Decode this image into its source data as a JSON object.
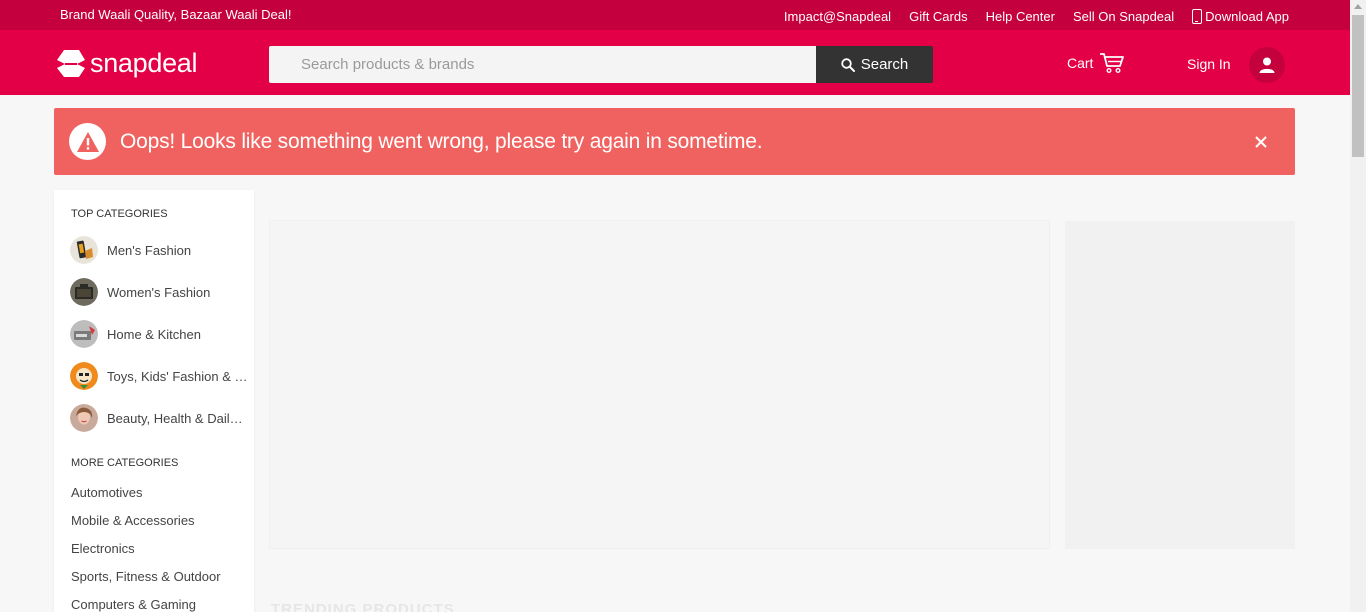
{
  "top_strip": {
    "tagline": "Brand Waali Quality, Bazaar Waali Deal!",
    "links": [
      "Impact@Snapdeal",
      "Gift Cards",
      "Help Center",
      "Sell On Snapdeal"
    ],
    "download_app": "Download App"
  },
  "header": {
    "logo_text": "snapdeal",
    "search_placeholder": "Search products & brands",
    "search_button": "Search",
    "cart_label": "Cart",
    "signin_label": "Sign In"
  },
  "error_banner": {
    "message": "Oops! Looks like something went wrong, please try again in sometime."
  },
  "sidebar": {
    "top_title": "TOP CATEGORIES",
    "top_categories": [
      {
        "label": "Men's Fashion",
        "icon": "mens-fashion-thumb"
      },
      {
        "label": "Women's Fashion",
        "icon": "womens-fashion-thumb"
      },
      {
        "label": "Home & Kitchen",
        "icon": "home-kitchen-thumb"
      },
      {
        "label": "Toys, Kids' Fashion & more",
        "icon": "toys-thumb"
      },
      {
        "label": "Beauty, Health & Daily Needs",
        "icon": "beauty-thumb"
      }
    ],
    "more_title": "MORE CATEGORIES",
    "more_categories": [
      "Automotives",
      "Mobile & Accessories",
      "Electronics",
      "Sports, Fitness & Outdoor",
      "Computers & Gaming"
    ]
  },
  "main": {
    "trending_title": "TRENDING PRODUCTS"
  },
  "colors": {
    "brand": "#e40046",
    "strip": "#c5003e",
    "error": "#f0625f",
    "search_button": "#333333"
  }
}
